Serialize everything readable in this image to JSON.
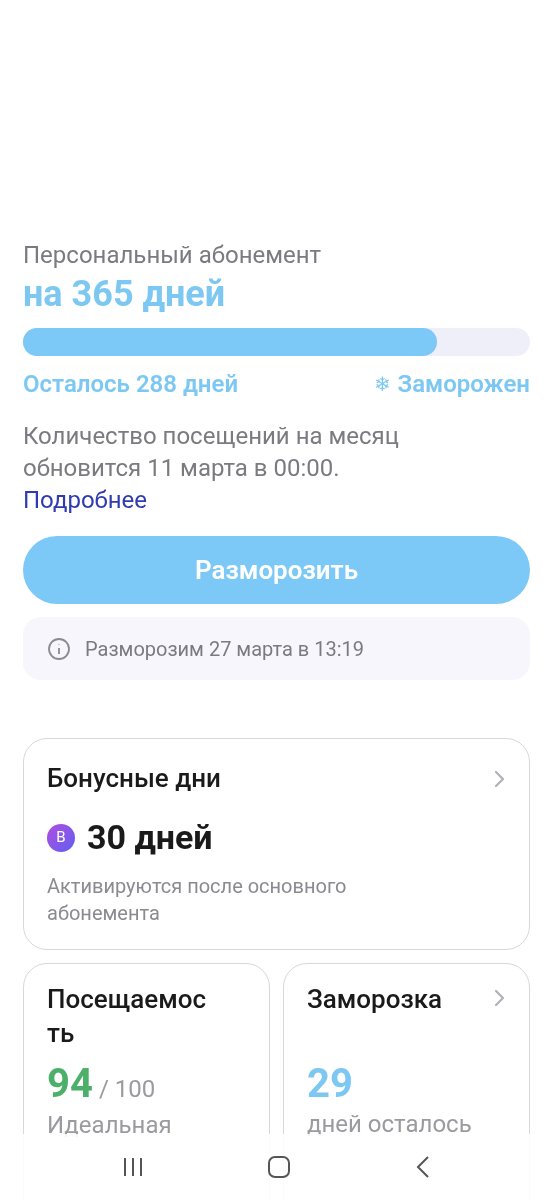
{
  "subscription": {
    "label": "Персональный абонемент",
    "title": "на 365 дней",
    "level": 0.816,
    "remaining": "Осталось 288 дней",
    "status_icon": "❄",
    "status": "Заморожен",
    "note": "Количество посещений на месяц обновится 11 марта в 00:00.",
    "link": "Подробнее"
  },
  "unfreeze_button": "Разморозить",
  "info": "Разморозим 27 марта в 13:19",
  "bonus_card": {
    "title": "Бонусные дни",
    "badge": "B",
    "value": "30 дней",
    "caption": "Активируются после основного абонемента"
  },
  "stat_cards": [
    {
      "title": "Посещаемость",
      "value": "94",
      "suffix": "/ 100",
      "caption": "Идеальная",
      "color": "#4caf6a",
      "chevron": false
    },
    {
      "title": "Заморозка",
      "value": "29",
      "caption": "дней осталось",
      "color": "#7cc8f2",
      "chevron": true
    }
  ]
}
